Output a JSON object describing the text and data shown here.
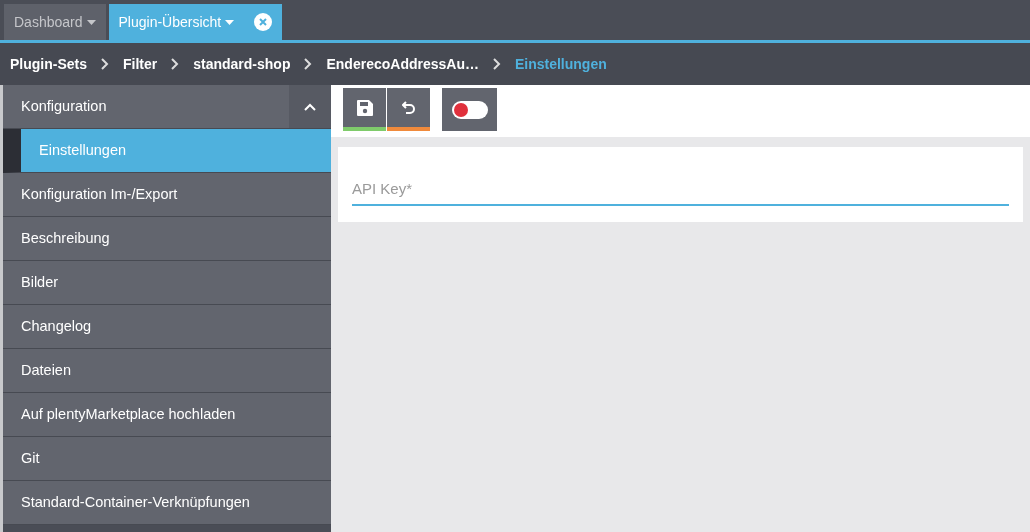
{
  "tabs": [
    {
      "label": "Dashboard",
      "selected": false,
      "closable": false
    },
    {
      "label": "Plugin-Übersicht",
      "selected": true,
      "closable": true
    }
  ],
  "breadcrumb": [
    {
      "label": "Plugin-Sets",
      "current": false
    },
    {
      "label": "Filter",
      "current": false
    },
    {
      "label": "standard-shop",
      "current": false
    },
    {
      "label": "EnderecoAddressAu…",
      "current": false
    },
    {
      "label": "Einstellungen",
      "current": true
    }
  ],
  "sidebar": {
    "items": [
      {
        "label": "Konfiguration",
        "selected": false,
        "expanded": true,
        "children": [
          {
            "label": "Einstellungen",
            "selected": true
          }
        ]
      },
      {
        "label": "Konfiguration Im-/Export",
        "selected": false
      },
      {
        "label": "Beschreibung",
        "selected": false
      },
      {
        "label": "Bilder",
        "selected": false
      },
      {
        "label": "Changelog",
        "selected": false
      },
      {
        "label": "Dateien",
        "selected": false
      },
      {
        "label": "Auf plentyMarketplace hochladen",
        "selected": false
      },
      {
        "label": "Git",
        "selected": false
      },
      {
        "label": "Standard-Container-Verknüpfungen",
        "selected": false
      }
    ]
  },
  "toolbar": {
    "active_toggle": {
      "on": false
    }
  },
  "form": {
    "api_key": {
      "placeholder": "API Key*"
    }
  }
}
